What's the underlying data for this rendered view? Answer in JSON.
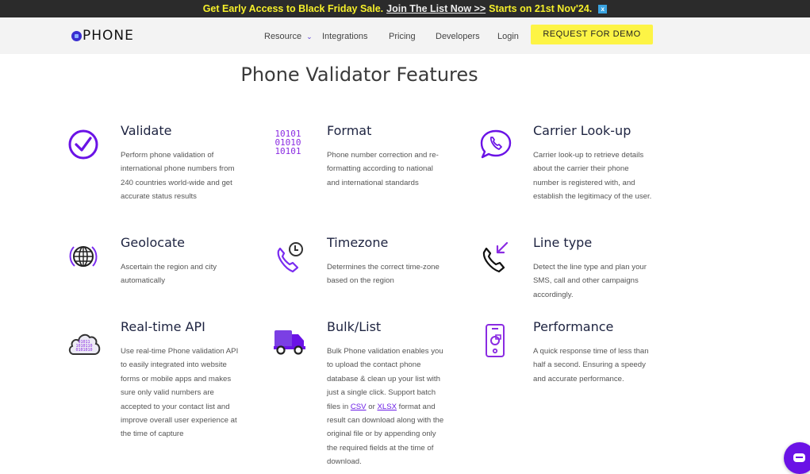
{
  "promo": {
    "text_before": "Get Early Access to Black Friday Sale.",
    "link": "Join The List Now >>",
    "text_after": "Starts on 21st Nov'24.",
    "close": "x"
  },
  "nav": {
    "logo": "PHONE",
    "items": [
      {
        "label": "Resource",
        "dropdown": true
      },
      {
        "label": "Integrations"
      },
      {
        "label": "Pricing"
      },
      {
        "label": "Developers"
      },
      {
        "label": "Login"
      }
    ],
    "cta": "REQUEST FOR DEMO"
  },
  "page_title": "Phone Validator Features",
  "features": [
    {
      "title": "Validate",
      "icon": "check-circle-icon",
      "desc": "Perform phone validation of international phone numbers from 240 countries world-wide and get accurate status results"
    },
    {
      "title": "Format",
      "icon": "binary-icon",
      "desc": "Phone number correction and re-formatting according to national and international standards"
    },
    {
      "title": "Carrier Look-up",
      "icon": "phone-bubble-icon",
      "desc": "Carrier look-up to retrieve details about the carrier their phone number is registered with, and establish the legitimacy of the user."
    },
    {
      "title": "Geolocate",
      "icon": "globe-icon",
      "desc": "Ascertain the region and city automatically"
    },
    {
      "title": "Timezone",
      "icon": "phone-clock-icon",
      "desc": "Determines the correct time-zone based on the region"
    },
    {
      "title": "Line type",
      "icon": "phone-incoming-icon",
      "desc": "Detect the line type and plan your SMS, call and other campaigns accordingly."
    },
    {
      "title": "Real-time API",
      "icon": "cloud-binary-icon",
      "desc": "Use real-time Phone validation API to easily integrated into website forms or mobile apps and makes sure only valid numbers are accepted to your contact list and improve overall user experience at the time of capture"
    },
    {
      "title": "Bulk/List",
      "icon": "truck-icon",
      "desc_before": "Bulk Phone validation enables you to upload the contact phone database & clean up your list with just a single click. Support batch files in ",
      "link1": "CSV",
      "desc_mid": " or ",
      "link2": "XLSX",
      "desc_after": " format and result can download along with the original file or by appending only the required fields at the time of download."
    },
    {
      "title": "Performance",
      "icon": "mobile-chart-icon",
      "desc": "A quick response time of less than half a second. Ensuring a speedy and accurate performance."
    }
  ],
  "binary_icon_lines": [
    "10101",
    "01010",
    "10101"
  ],
  "colors": {
    "accent": "#6a12e6",
    "promo_text": "#f5ef2a",
    "cta_bg": "#fdf445"
  }
}
